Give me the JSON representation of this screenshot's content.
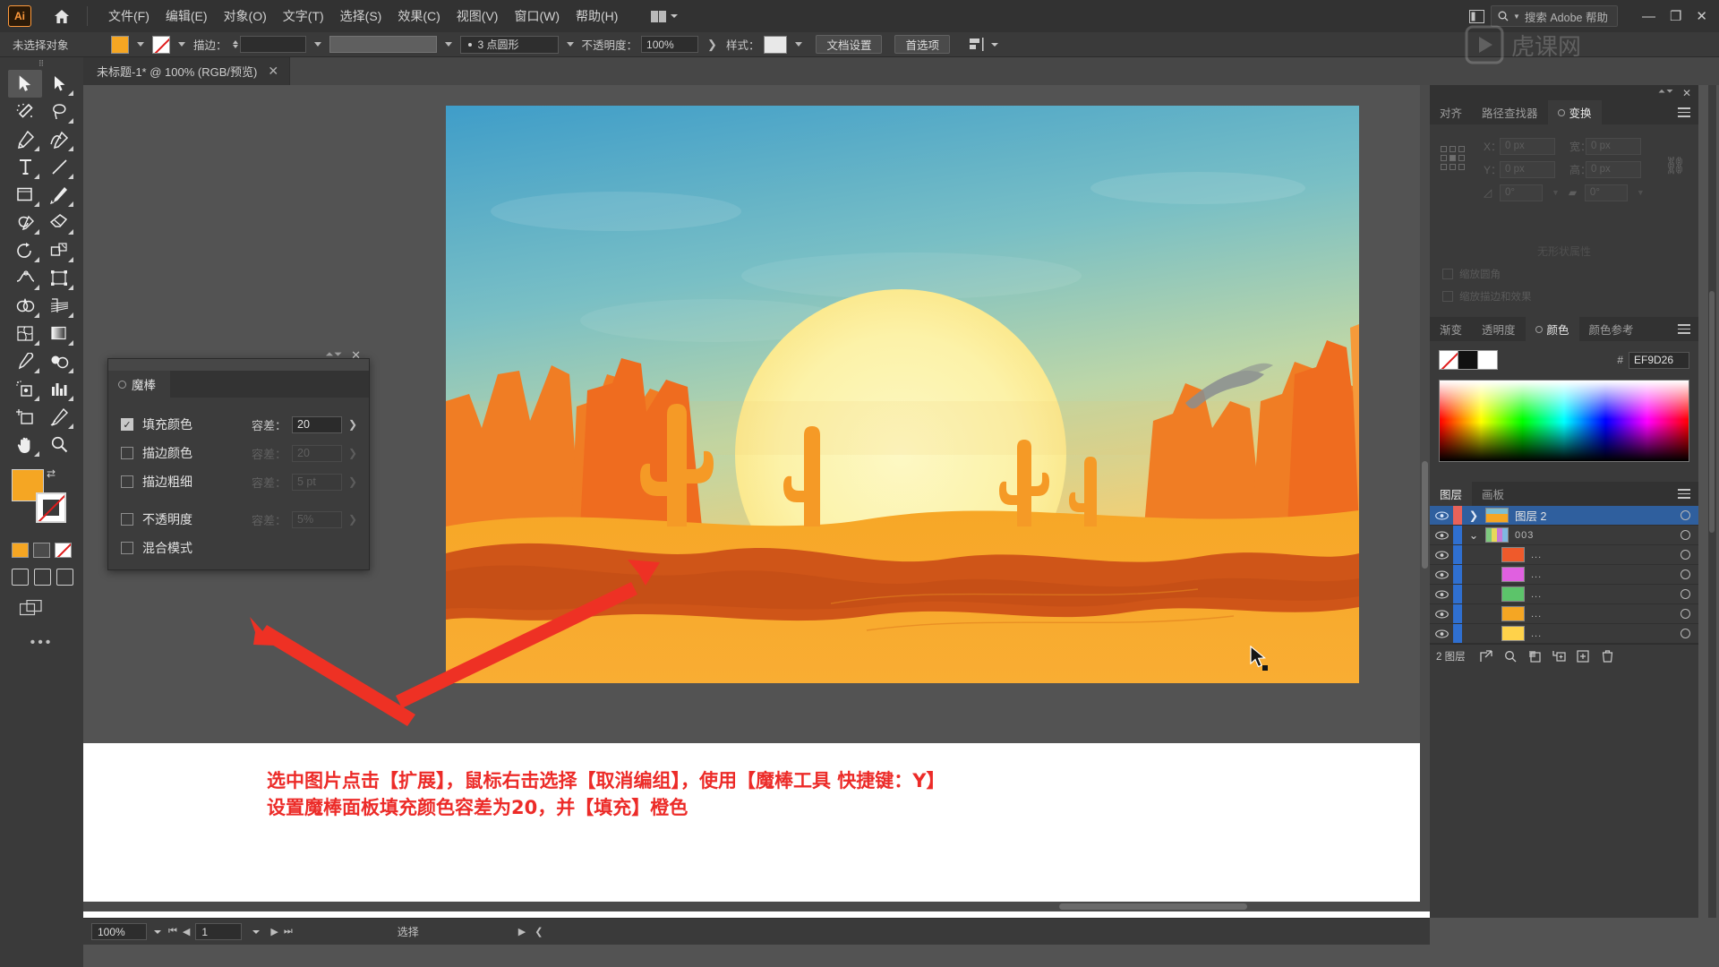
{
  "app": {
    "logo": "Ai",
    "title": "Adobe Illustrator"
  },
  "menubar": {
    "items": [
      {
        "label": "文件(F)"
      },
      {
        "label": "编辑(E)"
      },
      {
        "label": "对象(O)"
      },
      {
        "label": "文字(T)"
      },
      {
        "label": "选择(S)"
      },
      {
        "label": "效果(C)"
      },
      {
        "label": "视图(V)"
      },
      {
        "label": "窗口(W)"
      },
      {
        "label": "帮助(H)"
      }
    ],
    "search_placeholder": "搜索 Adobe 帮助",
    "home_icon": "home-icon",
    "arrange_icon": "arrange-documents-icon"
  },
  "controlbar": {
    "selection_status": "未选择对象",
    "fill_color": "#f5a623",
    "stroke_color": "#ffffff",
    "stroke_label": "描边：",
    "stroke_weight": "",
    "stroke_profile": "",
    "brush_definition": "3 点圆形",
    "opacity_label": "不透明度：",
    "opacity_value": "100%",
    "style_label": "样式：",
    "doc_setup_button": "文档设置",
    "preferences_button": "首选项"
  },
  "tabbar": {
    "document_tab": "未标题-1* @ 100% (RGB/预览)",
    "close_icon": "close-icon"
  },
  "toolbar": {
    "tools": [
      {
        "name": "selection-tool",
        "selected": true
      },
      {
        "name": "direct-selection-tool",
        "selected": false
      },
      {
        "name": "magic-wand-tool",
        "selected": false
      },
      {
        "name": "lasso-tool",
        "selected": false
      },
      {
        "name": "pen-tool",
        "selected": false
      },
      {
        "name": "curvature-tool",
        "selected": false
      },
      {
        "name": "type-tool",
        "selected": false
      },
      {
        "name": "line-segment-tool",
        "selected": false
      },
      {
        "name": "rectangle-tool",
        "selected": false
      },
      {
        "name": "paintbrush-tool",
        "selected": false
      },
      {
        "name": "shaper-tool",
        "selected": false
      },
      {
        "name": "eraser-tool",
        "selected": false
      },
      {
        "name": "rotate-tool",
        "selected": false
      },
      {
        "name": "scale-tool",
        "selected": false
      },
      {
        "name": "width-tool",
        "selected": false
      },
      {
        "name": "free-transform-tool",
        "selected": false
      },
      {
        "name": "shape-builder-tool",
        "selected": false
      },
      {
        "name": "perspective-grid-tool",
        "selected": false
      },
      {
        "name": "mesh-tool",
        "selected": false
      },
      {
        "name": "gradient-tool",
        "selected": false
      },
      {
        "name": "eyedropper-tool",
        "selected": false
      },
      {
        "name": "blend-tool",
        "selected": false
      },
      {
        "name": "symbol-sprayer-tool",
        "selected": false
      },
      {
        "name": "column-graph-tool",
        "selected": false
      },
      {
        "name": "artboard-tool",
        "selected": false
      },
      {
        "name": "slice-tool",
        "selected": false
      },
      {
        "name": "hand-tool",
        "selected": false
      },
      {
        "name": "zoom-tool",
        "selected": false
      }
    ],
    "fill_color": "#f5a623",
    "stroke_color": "#ffffff",
    "more_tools": "•••"
  },
  "magic_wand_panel": {
    "tab_label": "魔棒",
    "close_icon": "close-icon",
    "rows": [
      {
        "label": "填充颜色",
        "checked": true,
        "tolerance_label": "容差：",
        "tolerance_value": "20",
        "enabled": true
      },
      {
        "label": "描边颜色",
        "checked": false,
        "tolerance_label": "容差：",
        "tolerance_value": "20",
        "enabled": false
      },
      {
        "label": "描边粗细",
        "checked": false,
        "tolerance_label": "容差：",
        "tolerance_value": "5 pt",
        "enabled": false
      },
      {
        "label": "不透明度",
        "checked": false,
        "tolerance_label": "容差：",
        "tolerance_value": "5%",
        "enabled": false
      },
      {
        "label": "混合模式",
        "checked": false,
        "tolerance_label": "",
        "tolerance_value": "",
        "enabled": false
      }
    ]
  },
  "annotation": {
    "line1": "选中图片点击【扩展】，鼠标右击选择【取消编组】，使用【魔棒工具 快捷键：Y】",
    "line2": "设置魔棒面板填充颜色容差为20，并【填充】橙色",
    "color": "#ec2b28"
  },
  "transform_panel": {
    "tabs": [
      {
        "label": "对齐",
        "active": false
      },
      {
        "label": "路径查找器",
        "active": false
      },
      {
        "label": "变换",
        "active": true
      }
    ],
    "fields": {
      "x_label": "X：",
      "x_value": "0 px",
      "y_label": "Y：",
      "y_value": "0 px",
      "w_label": "宽：",
      "w_value": "0 px",
      "h_label": "高：",
      "h_value": "0 px",
      "angle_value": "0°",
      "shear_value": "0°"
    },
    "empty_text": "无形状属性",
    "checkboxes": [
      {
        "label": "缩放圆角"
      },
      {
        "label": "缩放描边和效果"
      }
    ],
    "menu_icon": "panel-menu-icon",
    "link_icon": "link-broken-icon"
  },
  "color_panel": {
    "tabs": [
      {
        "label": "渐变",
        "active": false
      },
      {
        "label": "透明度",
        "active": false
      },
      {
        "label": "颜色",
        "active": true
      },
      {
        "label": "颜色参考",
        "active": false
      }
    ],
    "hex_prefix": "#",
    "hex_value": "EF9D26",
    "menu_icon": "panel-menu-icon"
  },
  "layers_panel": {
    "tabs": [
      {
        "label": "图层",
        "active": true
      },
      {
        "label": "画板",
        "active": false
      }
    ],
    "rows": [
      {
        "name": "图层 2",
        "selected": true,
        "expanded": false,
        "indent": 0,
        "bar_color": "#e8625a",
        "thumb": "artwork",
        "eye_icon": "eye-icon",
        "target_icon": "target-circle-icon"
      },
      {
        "name": "003",
        "selected": false,
        "expanded": true,
        "indent": 1,
        "bar_color": "#2f6fd0",
        "thumb": "group",
        "eye_icon": "eye-icon",
        "target_icon": "target-circle-icon"
      },
      {
        "name": "...",
        "selected": false,
        "expanded": null,
        "indent": 2,
        "bar_color": "#2f6fd0",
        "thumb": "#ef5a2b",
        "eye_icon": "eye-icon",
        "target_icon": "target-circle-icon"
      },
      {
        "name": "...",
        "selected": false,
        "expanded": null,
        "indent": 2,
        "bar_color": "#2f6fd0",
        "thumb": "#e060e0",
        "eye_icon": "eye-icon",
        "target_icon": "target-circle-icon"
      },
      {
        "name": "...",
        "selected": false,
        "expanded": null,
        "indent": 2,
        "bar_color": "#2f6fd0",
        "thumb": "#5cc46a",
        "eye_icon": "eye-icon",
        "target_icon": "target-circle-icon"
      },
      {
        "name": "...",
        "selected": false,
        "expanded": null,
        "indent": 2,
        "bar_color": "#2f6fd0",
        "thumb": "#f5a623",
        "eye_icon": "eye-icon",
        "target_icon": "target-circle-icon"
      },
      {
        "name": "...",
        "selected": false,
        "expanded": null,
        "indent": 2,
        "bar_color": "#2f6fd0",
        "thumb": "#ffd24a",
        "eye_icon": "eye-icon",
        "target_icon": "target-circle-icon"
      }
    ],
    "footer": {
      "count": "2 图层",
      "icons": [
        "locate-object-icon",
        "search-icon",
        "new-sublayer-icon",
        "make-clipping-mask-icon",
        "new-layer-icon",
        "delete-layer-icon"
      ]
    }
  },
  "statusbar": {
    "zoom": "100%",
    "page": "1",
    "status_text": "选择",
    "first_icon": "first-page-icon",
    "prev_icon": "prev-page-icon",
    "next_icon": "next-page-icon",
    "last_icon": "last-page-icon"
  },
  "artwork": {
    "description": "desert-sunset-illustration",
    "sky_top": "#4aa3c7",
    "sky_mid": "#9ecab0",
    "sun": "#fdf6b4",
    "sand": "#f5a623",
    "rock_dark": "#c7441a",
    "rock_mid": "#ef6c1f"
  }
}
